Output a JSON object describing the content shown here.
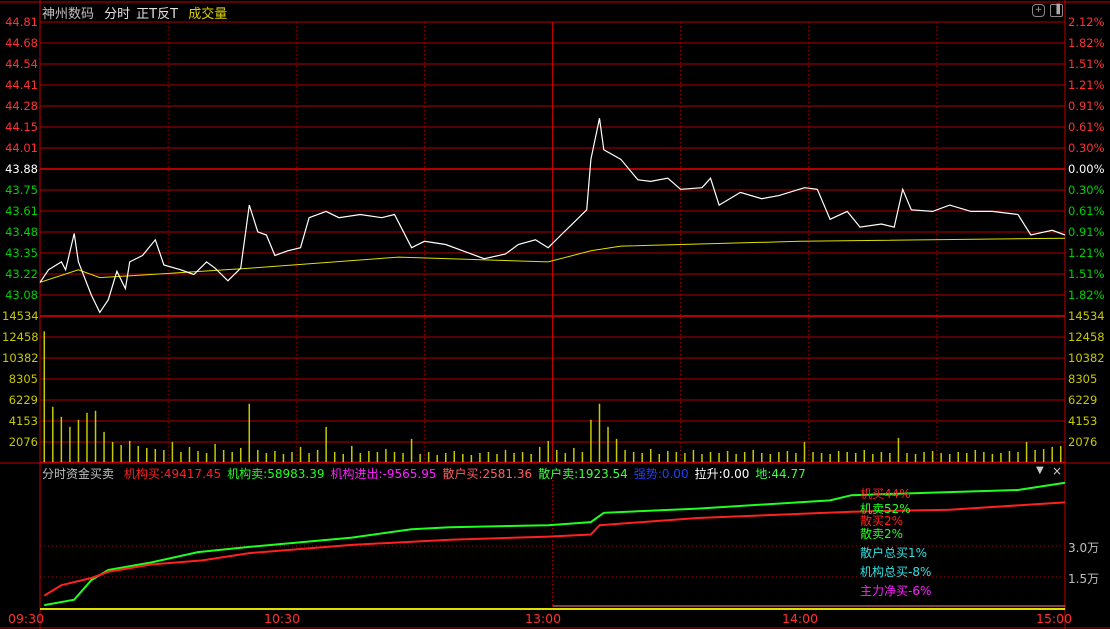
{
  "header": {
    "stock_name": "神州数码",
    "mode": "分时",
    "indicator": "正T反T",
    "volume_label": "成交量"
  },
  "colors": {
    "up": "#ff3232",
    "down": "#00d000",
    "flat": "#ffffff",
    "volume": "#c8c800",
    "grid": "#b00000",
    "price_line": "#ffffff",
    "avg_line": "#e0e000"
  },
  "price_axis": {
    "left": [
      "44.81",
      "44.68",
      "44.54",
      "44.41",
      "44.28",
      "44.15",
      "44.01",
      "43.88",
      "43.75",
      "43.61",
      "43.48",
      "43.35",
      "43.22",
      "43.08"
    ],
    "right": [
      "2.12%",
      "1.82%",
      "1.51%",
      "1.21%",
      "0.91%",
      "0.61%",
      "0.30%",
      "0.00%",
      "0.30%",
      "0.61%",
      "0.91%",
      "1.21%",
      "1.51%",
      "1.82%"
    ],
    "prev_close": 43.88,
    "max": 44.81,
    "min": 43.08
  },
  "volume_axis": {
    "labels": [
      "14534",
      "12458",
      "10382",
      "8305",
      "6229",
      "4153",
      "2076"
    ],
    "max": 14534
  },
  "lower_panel": {
    "title": "分时资金买卖",
    "items": [
      {
        "label": "机构买:",
        "value": "49417.45",
        "color": "#ff2020"
      },
      {
        "label": "机构卖:",
        "value": "58983.39",
        "color": "#20ff20"
      },
      {
        "label": "机构进出:",
        "value": "-9565.95",
        "color": "#ff20ff"
      },
      {
        "label": "散户买:",
        "value": "2581.36",
        "color": "#ff6060"
      },
      {
        "label": "散户卖:",
        "value": "1923.54",
        "color": "#40ff40"
      },
      {
        "label": "强势:",
        "value": "0.00",
        "color": "#2040ff"
      },
      {
        "label": "拉升:",
        "value": "0.00",
        "color": "#ffffff"
      },
      {
        "label": "地:",
        "value": "44.77",
        "color": "#40ff40"
      }
    ],
    "legend": [
      {
        "text": "机买44%",
        "color": "#ff2020"
      },
      {
        "text": "机卖52%",
        "color": "#20ff20"
      },
      {
        "text": "散买2%",
        "color": "#ff2020"
      },
      {
        "text": "散卖2%",
        "color": "#20ff20"
      },
      {
        "text": "散户总买1%",
        "color": "#30e0e0"
      },
      {
        "text": "机构总买-8%",
        "color": "#30e0e0"
      },
      {
        "text": "主力净买-6%",
        "color": "#ff20ff"
      }
    ],
    "axis_labels": [
      "3.0万",
      "1.5万"
    ],
    "collapse_icon": "triangle-down-icon",
    "close_icon": "close-icon"
  },
  "time_axis": [
    "09:30",
    "10:30",
    "13:00",
    "14:00",
    "15:00"
  ],
  "chart_data": {
    "type": "line",
    "x_unit": "minute index (0-240)",
    "price": [
      [
        0,
        43.16
      ],
      [
        2,
        43.24
      ],
      [
        5,
        43.29
      ],
      [
        6,
        43.24
      ],
      [
        8,
        43.47
      ],
      [
        9,
        43.29
      ],
      [
        12,
        43.08
      ],
      [
        14,
        42.97
      ],
      [
        16,
        43.05
      ],
      [
        18,
        43.23
      ],
      [
        20,
        43.12
      ],
      [
        21,
        43.29
      ],
      [
        24,
        43.33
      ],
      [
        27,
        43.43
      ],
      [
        29,
        43.27
      ],
      [
        33,
        43.24
      ],
      [
        36,
        43.21
      ],
      [
        39,
        43.29
      ],
      [
        41,
        43.25
      ],
      [
        44,
        43.17
      ],
      [
        47,
        43.25
      ],
      [
        49,
        43.65
      ],
      [
        51,
        43.48
      ],
      [
        53,
        43.46
      ],
      [
        55,
        43.33
      ],
      [
        58,
        43.36
      ],
      [
        61,
        43.38
      ],
      [
        63,
        43.57
      ],
      [
        67,
        43.61
      ],
      [
        70,
        43.57
      ],
      [
        75,
        43.59
      ],
      [
        80,
        43.57
      ],
      [
        83,
        43.59
      ],
      [
        87,
        43.38
      ],
      [
        90,
        43.42
      ],
      [
        95,
        43.4
      ],
      [
        99,
        43.36
      ],
      [
        104,
        43.31
      ],
      [
        109,
        43.34
      ],
      [
        112,
        43.4
      ],
      [
        116,
        43.43
      ],
      [
        119,
        43.38
      ],
      [
        122,
        43.46
      ],
      [
        125,
        43.54
      ],
      [
        128,
        43.62
      ],
      [
        129,
        43.94
      ],
      [
        131,
        44.2
      ],
      [
        132,
        44.0
      ],
      [
        136,
        43.94
      ],
      [
        140,
        43.81
      ],
      [
        143,
        43.8
      ],
      [
        147,
        43.82
      ],
      [
        150,
        43.75
      ],
      [
        155,
        43.76
      ],
      [
        157,
        43.82
      ],
      [
        159,
        43.65
      ],
      [
        164,
        43.73
      ],
      [
        169,
        43.69
      ],
      [
        173,
        43.71
      ],
      [
        179,
        43.76
      ],
      [
        182,
        43.75
      ],
      [
        185,
        43.56
      ],
      [
        189,
        43.61
      ],
      [
        192,
        43.51
      ],
      [
        197,
        43.53
      ],
      [
        200,
        43.51
      ],
      [
        202,
        43.75
      ],
      [
        204,
        43.62
      ],
      [
        209,
        43.61
      ],
      [
        213,
        43.65
      ],
      [
        218,
        43.61
      ],
      [
        223,
        43.61
      ],
      [
        229,
        43.59
      ],
      [
        232,
        43.46
      ],
      [
        237,
        43.49
      ],
      [
        240,
        43.46
      ]
    ],
    "avg_price": [
      [
        0,
        43.16
      ],
      [
        9,
        43.24
      ],
      [
        14,
        43.19
      ],
      [
        26,
        43.21
      ],
      [
        49,
        43.25
      ],
      [
        84,
        43.32
      ],
      [
        119,
        43.29
      ],
      [
        129,
        43.36
      ],
      [
        136,
        43.39
      ],
      [
        178,
        43.42
      ],
      [
        240,
        43.44
      ]
    ],
    "volume_2min": [
      13000,
      5500,
      4500,
      3500,
      4200,
      4900,
      5100,
      3000,
      2000,
      1700,
      2100,
      1600,
      1400,
      1300,
      1200,
      2000,
      1000,
      1500,
      1100,
      900,
      1800,
      1200,
      1000,
      1400,
      5800,
      1200,
      900,
      1100,
      800,
      1000,
      1500,
      900,
      1200,
      3500,
      1000,
      800,
      1600,
      900,
      1100,
      1000,
      1300,
      1000,
      900,
      2300,
      800,
      1000,
      700,
      900,
      1100,
      800,
      700,
      900,
      1000,
      800,
      1200,
      900,
      1000,
      800,
      1500,
      2100,
      1200,
      900,
      1400,
      1000,
      4200,
      5800,
      3500,
      2300,
      1200,
      1000,
      900,
      1300,
      800,
      1100,
      1000,
      900,
      1200,
      800,
      1000,
      900,
      1100,
      800,
      1000,
      1200,
      900,
      800,
      1000,
      1100,
      900,
      2000,
      1000,
      900,
      800,
      1100,
      1000,
      900,
      1200,
      800,
      1000,
      900,
      2400,
      900,
      800,
      1000,
      1100,
      900,
      800,
      1000,
      900,
      1200,
      1000,
      800,
      900,
      1100,
      1000,
      2000,
      1200,
      1300,
      1500,
      1600
    ],
    "inst_buy_wan": [
      [
        1,
        0.6
      ],
      [
        5,
        1.1
      ],
      [
        12,
        1.45
      ],
      [
        16,
        1.75
      ],
      [
        26,
        2.1
      ],
      [
        38,
        2.3
      ],
      [
        49,
        2.65
      ],
      [
        73,
        3.05
      ],
      [
        96,
        3.3
      ],
      [
        119,
        3.45
      ],
      [
        129,
        3.55
      ],
      [
        131,
        4.0
      ],
      [
        154,
        4.35
      ],
      [
        190,
        4.65
      ],
      [
        213,
        4.75
      ],
      [
        240,
        5.1
      ]
    ],
    "inst_sell_wan": [
      [
        1,
        0.14
      ],
      [
        8,
        0.4
      ],
      [
        12,
        1.35
      ],
      [
        16,
        1.84
      ],
      [
        26,
        2.2
      ],
      [
        37,
        2.7
      ],
      [
        49,
        2.95
      ],
      [
        73,
        3.4
      ],
      [
        87,
        3.8
      ],
      [
        96,
        3.9
      ],
      [
        119,
        4.0
      ],
      [
        129,
        4.15
      ],
      [
        132,
        4.6
      ],
      [
        154,
        4.8
      ],
      [
        185,
        5.2
      ],
      [
        190,
        5.45
      ],
      [
        229,
        5.7
      ],
      [
        240,
        6.05
      ]
    ],
    "lower_ylim_wan": [
      0,
      7
    ]
  }
}
